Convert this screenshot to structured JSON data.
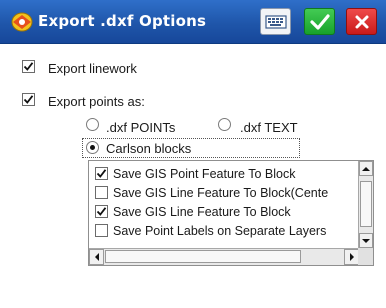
{
  "window": {
    "title": "Export .dxf Options"
  },
  "titlebar_buttons": {
    "keyboard_icon": "keyboard-icon",
    "ok_icon": "checkmark-icon",
    "close_icon": "close-icon"
  },
  "options": {
    "export_linework": {
      "label": "Export linework",
      "checked": true
    },
    "export_points": {
      "label": "Export points as:",
      "checked": true
    },
    "radio_dxf_points": {
      "label": ".dxf POINTs",
      "selected": false
    },
    "radio_dxf_text": {
      "label": ".dxf TEXT",
      "selected": false
    },
    "radio_carlson_blocks": {
      "label": "Carlson blocks",
      "selected": true
    }
  },
  "list": {
    "items": [
      {
        "label": "Save GIS Point Feature To Block",
        "checked": true
      },
      {
        "label": "Save GIS Line Feature To Block(Cente",
        "checked": false
      },
      {
        "label": "Save GIS Line Feature To Block",
        "checked": true
      },
      {
        "label": "Save Point Labels on Separate Layers",
        "checked": false
      }
    ]
  },
  "colors": {
    "titlebar": "#1f56aa",
    "ok_green": "#18a22b",
    "close_red": "#c91b1b"
  }
}
